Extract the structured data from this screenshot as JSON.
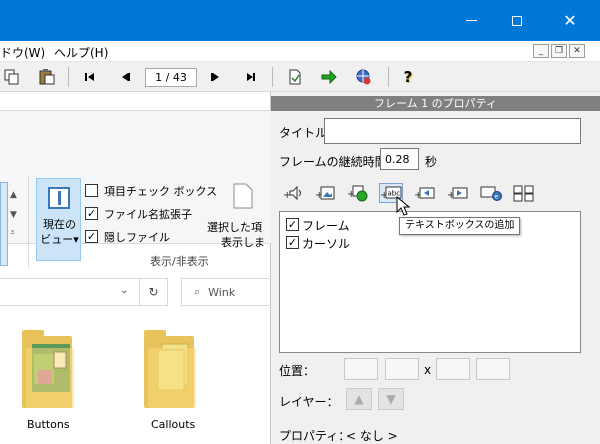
{
  "menubar": {
    "window_menu": "ドウ(W)",
    "help_menu": "ヘルプ(H)"
  },
  "toolbar": {
    "page_indicator": "1 / 43"
  },
  "explorer": {
    "view_button_label": [
      "現在の",
      "ビュー▾"
    ],
    "checkboxes": [
      {
        "label": "項目チェック ボックス",
        "checked": false
      },
      {
        "label": "ファイル名拡張子",
        "checked": true
      },
      {
        "label": "隠しファイル",
        "checked": true
      }
    ],
    "partial_label_1": "選択した項",
    "partial_label_2": "表示しま",
    "group_label": "表示/非表示",
    "search_placeholder": "Wink",
    "folders": [
      {
        "name": "Buttons"
      },
      {
        "name": "Callouts"
      }
    ]
  },
  "panel": {
    "header": "フレーム 1 のプロパティ",
    "title_label": "タイトル",
    "title_value": "",
    "duration_label": "フレームの継続時間",
    "duration_value": "0.28",
    "duration_unit": "秒",
    "tooltip": "テキストボックスの追加",
    "list_items": [
      {
        "label": "フレーム",
        "checked": true
      },
      {
        "label": "カーソル",
        "checked": true
      }
    ],
    "position_label": "位置：",
    "position_x": "x",
    "layer_label": "レイヤー：",
    "property_label": "プロパティ：",
    "property_value": "< なし >"
  }
}
